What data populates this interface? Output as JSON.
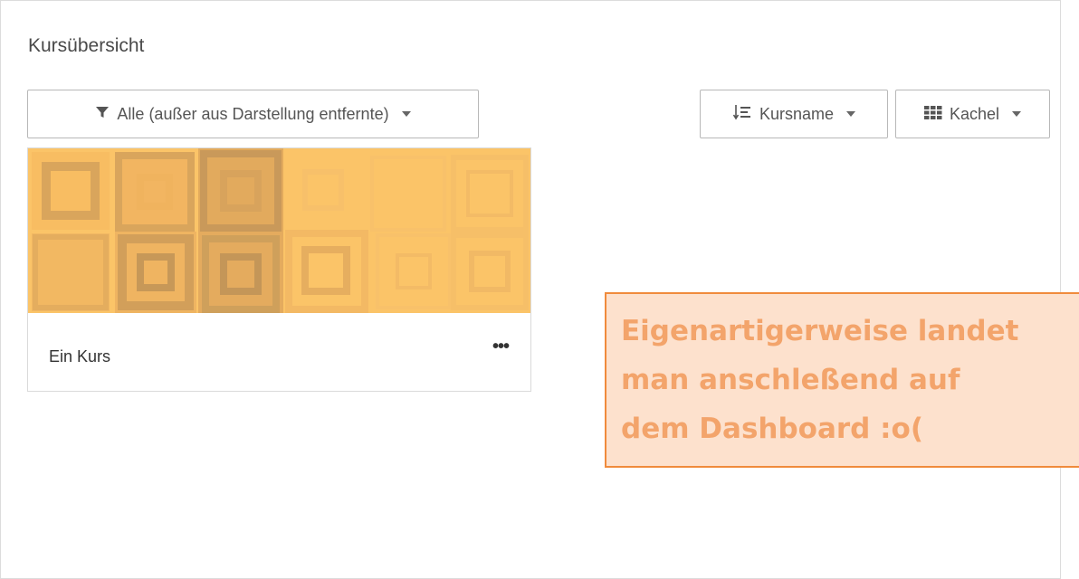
{
  "block": {
    "title": "Kursübersicht"
  },
  "toolbar": {
    "filter_label": "Alle (außer aus Darstellung entfernte)",
    "sort_label": "Kursname",
    "view_label": "Kachel"
  },
  "course": {
    "name": "Ein Kurs",
    "menu_label": "•••",
    "image_color": "#fbc468"
  },
  "annotation": {
    "text": "Eigenartigerweise landet\nman anschleßend auf\ndem Dashboard :o("
  },
  "colors": {
    "note_border": "#f08b3c",
    "note_fill": "#fde1cd",
    "note_text": "#f3a46b"
  }
}
